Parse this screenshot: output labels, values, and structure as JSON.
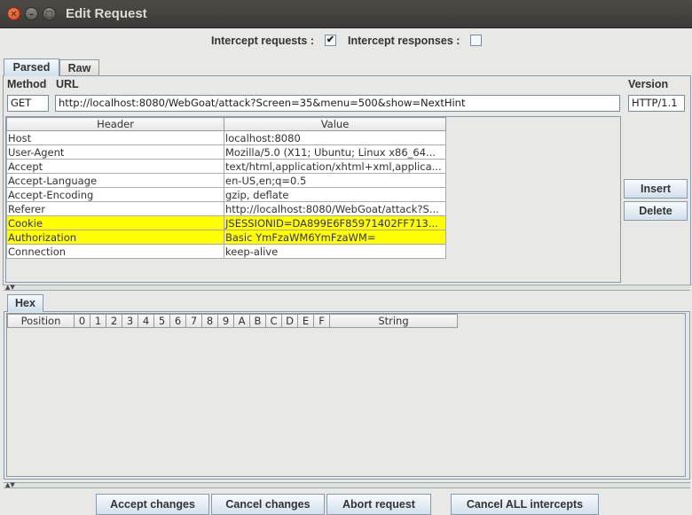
{
  "window": {
    "title": "Edit Request"
  },
  "intercept": {
    "requests_label": "Intercept requests :",
    "requests_checked": true,
    "responses_label": "Intercept responses :",
    "responses_checked": false
  },
  "tabs": [
    {
      "label": "Parsed",
      "active": true
    },
    {
      "label": "Raw",
      "active": false
    }
  ],
  "request": {
    "method_label": "Method",
    "url_label": "URL",
    "version_label": "Version",
    "method": "GET",
    "url": "http://localhost:8080/WebGoat/attack?Screen=35&menu=500&show=NextHint",
    "version": "HTTP/1.1"
  },
  "headers_table": {
    "columns": [
      "Header",
      "Value"
    ],
    "rows": [
      {
        "header": "Host",
        "value": "localhost:8080",
        "highlighted": false
      },
      {
        "header": "User-Agent",
        "value": "Mozilla/5.0 (X11; Ubuntu; Linux x86_64...",
        "highlighted": false
      },
      {
        "header": "Accept",
        "value": "text/html,application/xhtml+xml,applica...",
        "highlighted": false
      },
      {
        "header": "Accept-Language",
        "value": "en-US,en;q=0.5",
        "highlighted": false
      },
      {
        "header": "Accept-Encoding",
        "value": "gzip, deflate",
        "highlighted": false
      },
      {
        "header": "Referer",
        "value": "http://localhost:8080/WebGoat/attack?S...",
        "highlighted": false
      },
      {
        "header": "Cookie",
        "value": "JSESSIONID=DA899E6F85971402FF713...",
        "highlighted": true
      },
      {
        "header": "Authorization",
        "value": "Basic YmFzaWM6YmFzaWM=",
        "highlighted": true
      },
      {
        "header": "Connection",
        "value": "keep-alive",
        "highlighted": false
      }
    ],
    "highlight_color": "#ffff00"
  },
  "side_buttons": {
    "insert": "Insert",
    "delete": "Delete"
  },
  "hex": {
    "tab_label": "Hex",
    "columns": [
      "Position",
      "0",
      "1",
      "2",
      "3",
      "4",
      "5",
      "6",
      "7",
      "8",
      "9",
      "A",
      "B",
      "C",
      "D",
      "E",
      "F",
      "String"
    ]
  },
  "bottom_buttons": {
    "accept": "Accept changes",
    "cancel": "Cancel changes",
    "abort": "Abort request",
    "cancel_all": "Cancel ALL intercepts"
  },
  "colors": {
    "titlebar": "#3c3b37",
    "accent": "#d2e0ec",
    "close": "#e95420"
  }
}
